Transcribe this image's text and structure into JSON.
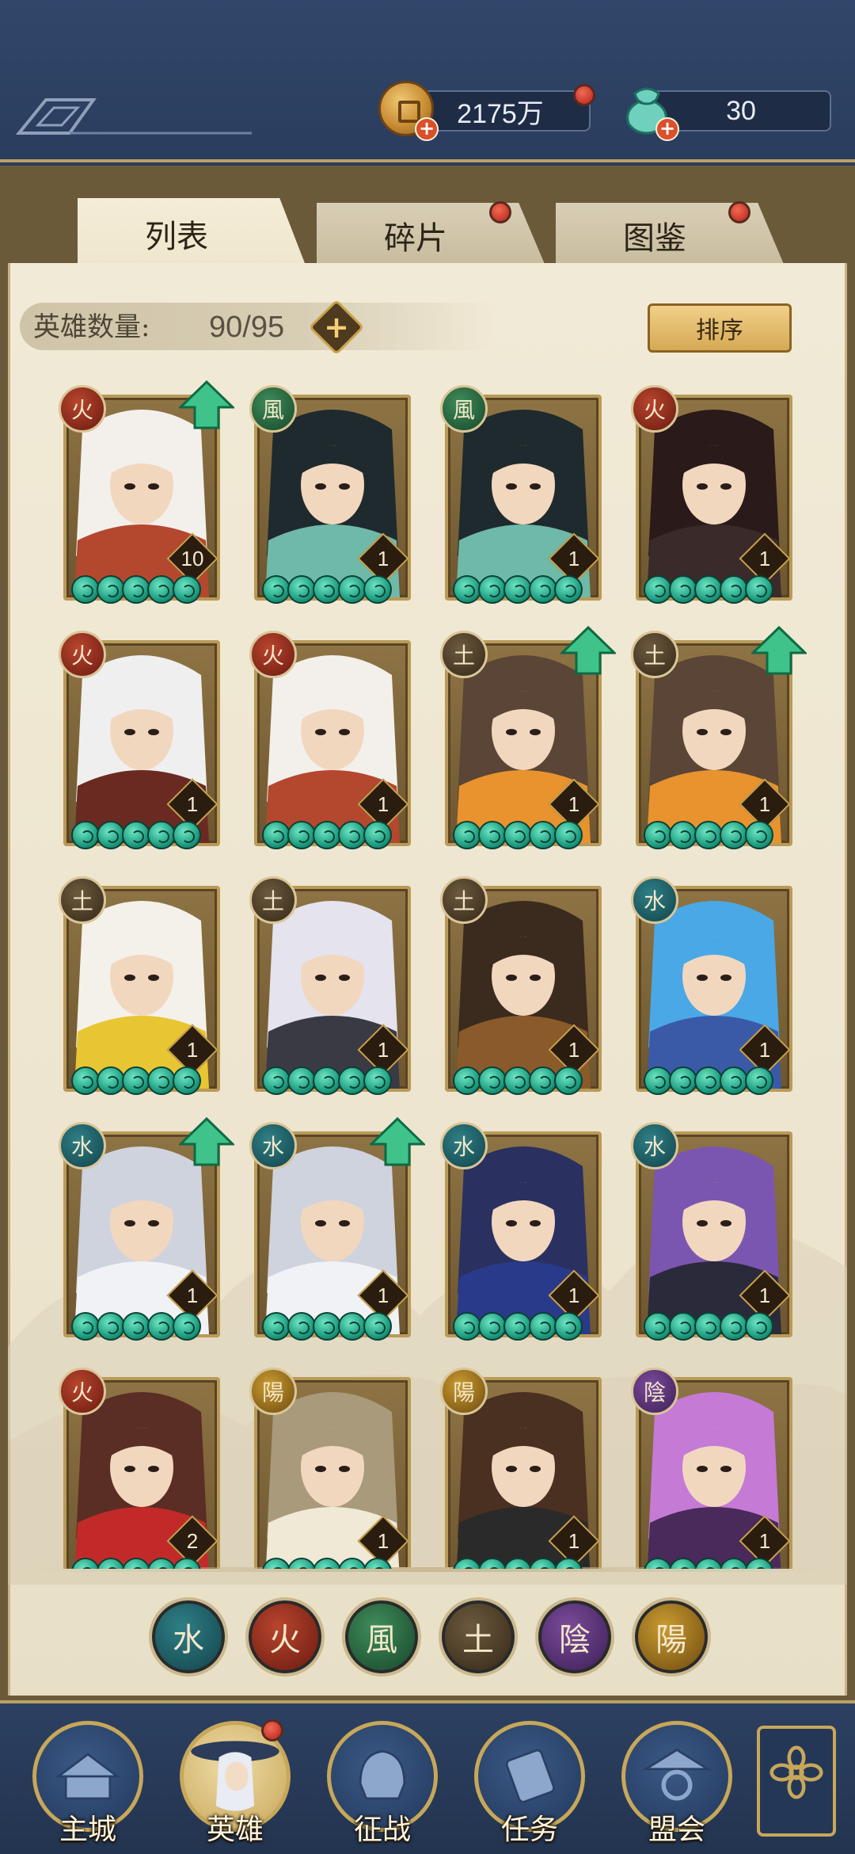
{
  "currency": {
    "coins": "2175万",
    "jade": "30"
  },
  "tabs": [
    {
      "label": "列表",
      "active": true,
      "dot": false
    },
    {
      "label": "碎片",
      "active": false,
      "dot": true
    },
    {
      "label": "图鉴",
      "active": false,
      "dot": true
    }
  ],
  "hero_count": {
    "label": "英雄数量:",
    "value": "90/95"
  },
  "sort_label": "排序",
  "heroes": [
    {
      "element": "火",
      "level": "10",
      "upgrade": true
    },
    {
      "element": "風",
      "level": "1",
      "upgrade": false
    },
    {
      "element": "風",
      "level": "1",
      "upgrade": false
    },
    {
      "element": "火",
      "level": "1",
      "upgrade": false
    },
    {
      "element": "火",
      "level": "1",
      "upgrade": false
    },
    {
      "element": "火",
      "level": "1",
      "upgrade": false
    },
    {
      "element": "土",
      "level": "1",
      "upgrade": true
    },
    {
      "element": "土",
      "level": "1",
      "upgrade": true
    },
    {
      "element": "土",
      "level": "1",
      "upgrade": false
    },
    {
      "element": "土",
      "level": "1",
      "upgrade": false
    },
    {
      "element": "土",
      "level": "1",
      "upgrade": false
    },
    {
      "element": "水",
      "level": "1",
      "upgrade": false
    },
    {
      "element": "水",
      "level": "1",
      "upgrade": true
    },
    {
      "element": "水",
      "level": "1",
      "upgrade": true
    },
    {
      "element": "水",
      "level": "1",
      "upgrade": false
    },
    {
      "element": "水",
      "level": "1",
      "upgrade": false
    },
    {
      "element": "火",
      "level": "2",
      "upgrade": false
    },
    {
      "element": "陽",
      "level": "1",
      "upgrade": false
    },
    {
      "element": "陽",
      "level": "1",
      "upgrade": false
    },
    {
      "element": "陰",
      "level": "1",
      "upgrade": false
    }
  ],
  "filters": [
    "水",
    "火",
    "風",
    "土",
    "陰",
    "陽"
  ],
  "nav": [
    {
      "label": "主城",
      "icon": "palace-icon"
    },
    {
      "label": "英雄",
      "icon": "hero-portrait-icon"
    },
    {
      "label": "征战",
      "icon": "helmet-icon"
    },
    {
      "label": "任务",
      "icon": "scroll-icon"
    },
    {
      "label": "盟会",
      "icon": "pavilion-icon"
    }
  ],
  "colors": {
    "topbar": "#2b3d5a",
    "gold": "#c7a759",
    "parchment": "#efe6cd",
    "jade_star": "#1f9f82"
  }
}
